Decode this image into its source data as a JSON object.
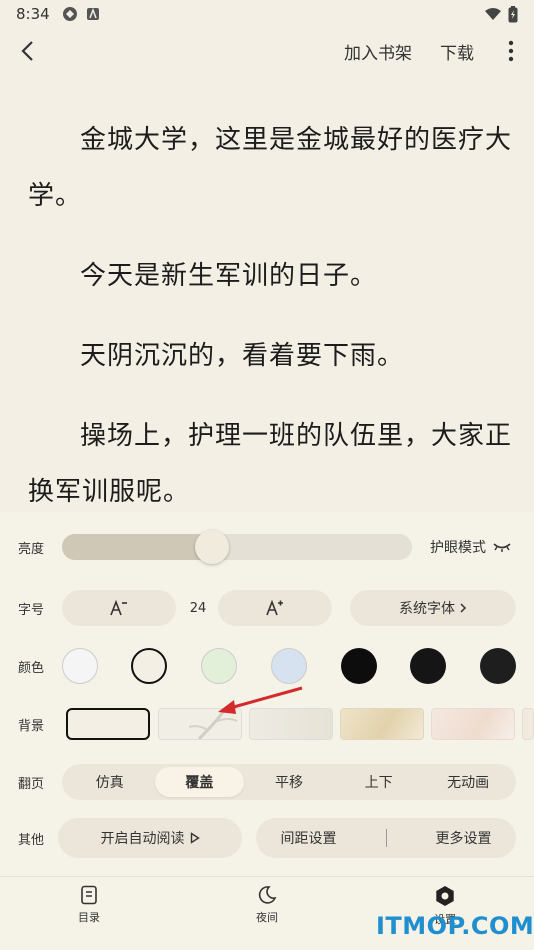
{
  "status": {
    "time": "8:34"
  },
  "header": {
    "add_shelf": "加入书架",
    "download": "下载"
  },
  "content": {
    "paragraphs": [
      "金城大学，这里是金城最好的医疗大学。",
      "今天是新生军训的日子。",
      "天阴沉沉的，看着要下雨。",
      "操场上，护理一班的队伍里，大家正换军训服呢。"
    ]
  },
  "settings": {
    "brightness": {
      "label": "亮度",
      "value": 0.42,
      "eye_mode_label": "护眼模式"
    },
    "font": {
      "label": "字号",
      "size": "24",
      "font_button": "系统字体"
    },
    "color": {
      "label": "颜色",
      "swatches": [
        "#f5f5f5",
        "#f3efe4",
        "#e2efd9",
        "#d7e2f0",
        "#0d0d0d",
        "#151515",
        "#1e1e1e"
      ],
      "selected_index": 1
    },
    "background": {
      "label": "背景",
      "selected_index": 0
    },
    "page_turn": {
      "label": "翻页",
      "options": [
        "仿真",
        "覆盖",
        "平移",
        "上下",
        "无动画"
      ],
      "selected_index": 1
    },
    "other": {
      "label": "其他",
      "auto_read": "开启自动阅读",
      "spacing": "间距设置",
      "more": "更多设置"
    }
  },
  "bottom_nav": {
    "toc": "目录",
    "night": "夜间",
    "settings": "设置"
  },
  "watermark": "ITMOP.COM"
}
